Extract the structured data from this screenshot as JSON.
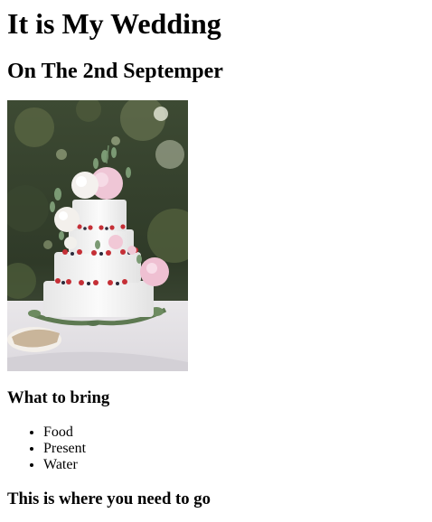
{
  "heading": {
    "title": "It is My Wedding",
    "subtitle": "On The 2nd Septemper"
  },
  "image": {
    "subject": "wedding-cake-photo"
  },
  "bring_section": {
    "heading": "What to bring",
    "items": [
      "Food",
      "Present",
      "Water"
    ]
  },
  "location_section": {
    "heading": "This is where you need to go"
  },
  "colors": {
    "background": "#ffffff",
    "text": "#000000"
  }
}
